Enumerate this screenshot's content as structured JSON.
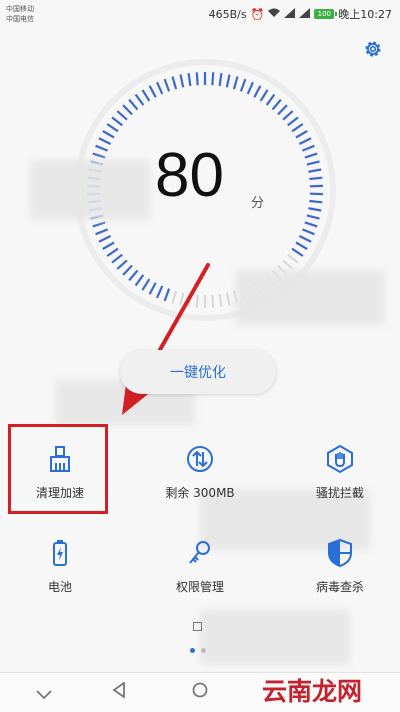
{
  "status_bar": {
    "carrier_1": "中国移动",
    "carrier_2": "中国电信",
    "speed": "465B/s",
    "battery": "100",
    "time": "晚上10:27"
  },
  "score": {
    "value": "80",
    "unit": "分"
  },
  "optimize_button": "一键优化",
  "tools": [
    {
      "label": "清理加速",
      "icon": "broom-icon"
    },
    {
      "label": "剩余 300MB",
      "icon": "data-traffic-icon"
    },
    {
      "label": "骚扰拦截",
      "icon": "shield-hand-icon"
    },
    {
      "label": "电池",
      "icon": "battery-icon"
    },
    {
      "label": "权限管理",
      "icon": "key-icon"
    },
    {
      "label": "病毒查杀",
      "icon": "antivirus-shield-icon"
    }
  ],
  "watermark": "云南龙网",
  "colors": {
    "accent": "#2a6fd6",
    "annotation": "#d32027",
    "battery": "#3cb043"
  }
}
